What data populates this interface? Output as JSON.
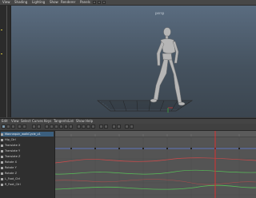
{
  "viewport_menu": {
    "items": [
      "View",
      "Shading",
      "Lighting",
      "Show",
      "Renderer",
      "Panels"
    ]
  },
  "viewport": {
    "camera_label": "persp"
  },
  "graph_menu": {
    "items": [
      "Edit",
      "View",
      "Select",
      "Curves",
      "Keys",
      "Tangents",
      "List",
      "Show",
      "Help"
    ]
  },
  "outliner": {
    "items": [
      {
        "label": "Mannequin_walkCycle_v1"
      },
      {
        "label": "Hip_Ctrl"
      },
      {
        "label": "Translate X"
      },
      {
        "label": "Translate Y"
      },
      {
        "label": "Translate Z"
      },
      {
        "label": "Rotate X"
      },
      {
        "label": "Rotate Y"
      },
      {
        "label": "Rotate Z"
      },
      {
        "label": "L_Foot_Ctrl"
      },
      {
        "label": "R_Foot_Ctrl"
      }
    ]
  },
  "curve_colors": {
    "red": "#d24a4a",
    "green": "#58c058",
    "blue": "#5f7fe0",
    "time_marker": "#d83030"
  }
}
